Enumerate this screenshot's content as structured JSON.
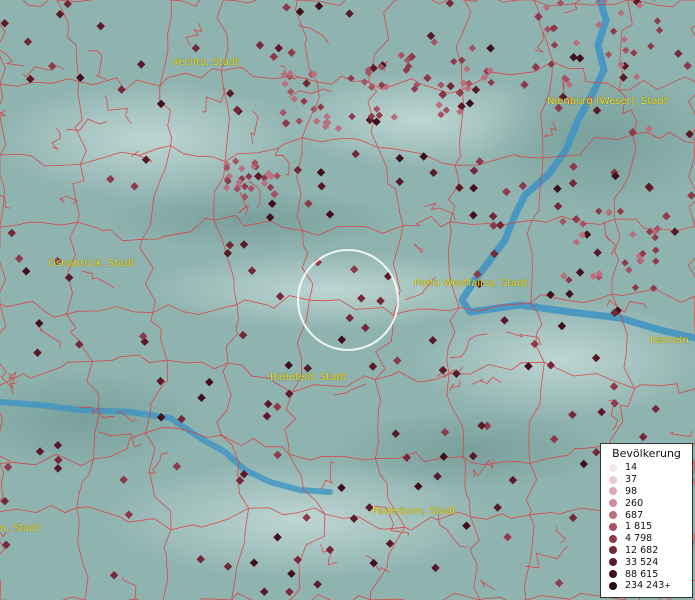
{
  "cities": [
    {
      "name": "Vechta, Stadt"
    },
    {
      "name": "Nienburg (Weser), Stadt"
    },
    {
      "name": "Osnabrück, Stadt"
    },
    {
      "name": "Porta Westfalica, Stadt"
    },
    {
      "name": "Hameln"
    },
    {
      "name": "Bielefeld, Stadt"
    },
    {
      "name": "Paderborn, Stadt"
    },
    {
      "name": "n, Stadt"
    }
  ],
  "legend": {
    "title": "Bevölkerung",
    "items": [
      {
        "label": "14",
        "color": "#f6e4ea"
      },
      {
        "label": "37",
        "color": "#ecc8d2"
      },
      {
        "label": "98",
        "color": "#dcaab6"
      },
      {
        "label": "260",
        "color": "#cc8c99"
      },
      {
        "label": "687",
        "color": "#bb6f7d"
      },
      {
        "label": "1 815",
        "color": "#a55262"
      },
      {
        "label": "4 798",
        "color": "#8e3a4a"
      },
      {
        "label": "12 682",
        "color": "#742838"
      },
      {
        "label": "33 524",
        "color": "#5a1a28"
      },
      {
        "label": "88 615",
        "color": "#40101b"
      },
      {
        "label": "234 243",
        "color": "#25080f",
        "suffix": "+"
      }
    ]
  }
}
